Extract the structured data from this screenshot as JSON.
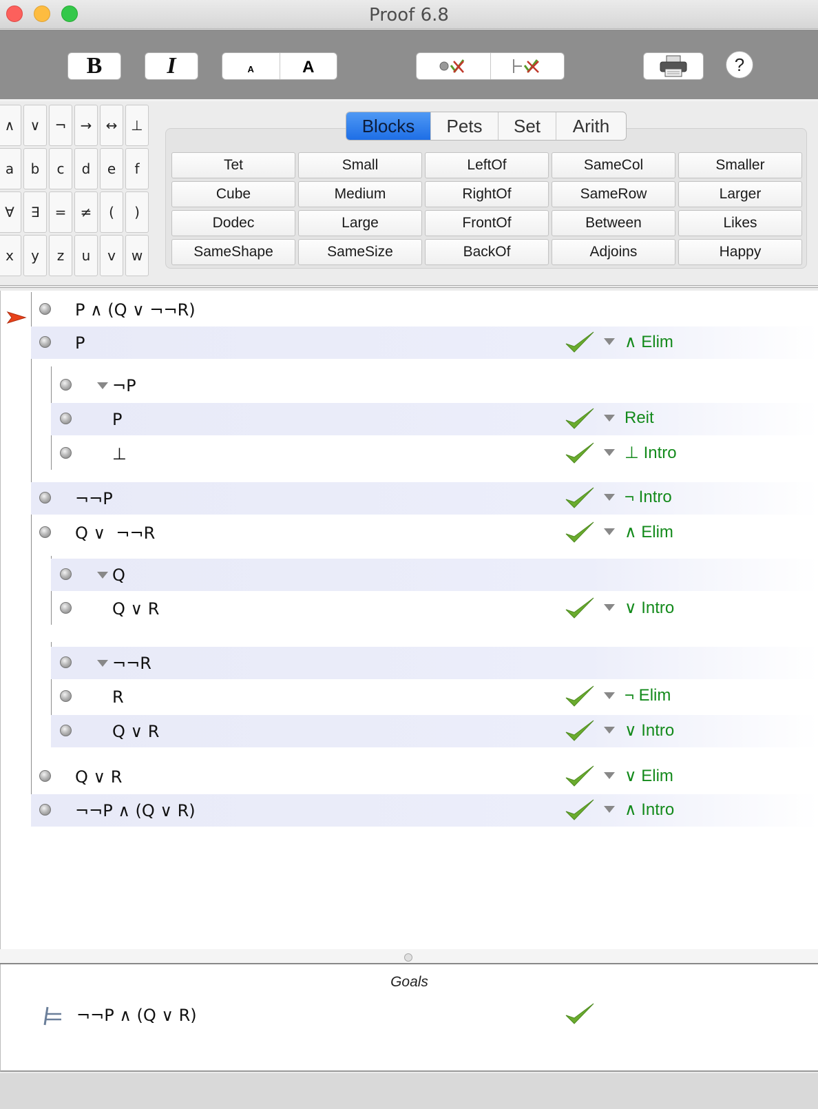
{
  "window": {
    "title": "Proof 6.8"
  },
  "toolbar": {
    "bold_label": "B",
    "italic_label": "I",
    "font_small_label": "A",
    "font_large_label": "A",
    "help_label": "?"
  },
  "symbols": {
    "row1": [
      "∧",
      "∨",
      "¬",
      "→",
      "↔",
      "⊥"
    ],
    "row2": [
      "a",
      "b",
      "c",
      "d",
      "e",
      "f"
    ],
    "row3": [
      "∀",
      "∃",
      "=",
      "≠",
      "(",
      ")"
    ],
    "row4": [
      "x",
      "y",
      "z",
      "u",
      "v",
      "w"
    ]
  },
  "tabs": [
    {
      "label": "Blocks",
      "active": true
    },
    {
      "label": "Pets",
      "active": false
    },
    {
      "label": "Set",
      "active": false
    },
    {
      "label": "Arith",
      "active": false
    }
  ],
  "predicates": [
    [
      "Tet",
      "Small",
      "LeftOf",
      "SameCol",
      "Smaller"
    ],
    [
      "Cube",
      "Medium",
      "RightOf",
      "SameRow",
      "Larger"
    ],
    [
      "Dodec",
      "Large",
      "FrontOf",
      "Between",
      "Likes"
    ],
    [
      "SameShape",
      "SameSize",
      "BackOf",
      "Adjoins",
      "Happy"
    ]
  ],
  "proof": {
    "steps": [
      {
        "formula": "P ∧ (Q ∨ ¬¬R)",
        "rule": "",
        "checked": false
      },
      {
        "formula": "P",
        "rule": "∧ Elim",
        "checked": true
      },
      {
        "formula": "¬P",
        "rule": "",
        "checked": false
      },
      {
        "formula": "P",
        "rule": "Reit",
        "checked": true
      },
      {
        "formula": "⊥",
        "rule": "⊥ Intro",
        "checked": true
      },
      {
        "formula": "¬¬P",
        "rule": "¬ Intro",
        "checked": true
      },
      {
        "formula": "Q ∨  ¬¬R",
        "rule": "∧ Elim",
        "checked": true
      },
      {
        "formula": "Q",
        "rule": "",
        "checked": false
      },
      {
        "formula": "Q ∨ R",
        "rule": "∨ Intro",
        "checked": true
      },
      {
        "formula": "¬¬R",
        "rule": "",
        "checked": false
      },
      {
        "formula": "R",
        "rule": "¬ Elim",
        "checked": true
      },
      {
        "formula": "Q ∨ R",
        "rule": "∨ Intro",
        "checked": true
      },
      {
        "formula": "Q ∨ R",
        "rule": "∨ Elim",
        "checked": true
      },
      {
        "formula": "¬¬P ∧ (Q ∨ R)",
        "rule": "∧ Intro",
        "checked": true
      }
    ]
  },
  "goals": {
    "title": "Goals",
    "items": [
      {
        "formula": "¬¬P ∧ (Q ∨ R)",
        "satisfied": true
      }
    ]
  },
  "colors": {
    "rule_text": "#138a1b",
    "check": "#6aab2e",
    "active_tab": "#2a7ae8",
    "focus_arrow": "#e8421a"
  }
}
